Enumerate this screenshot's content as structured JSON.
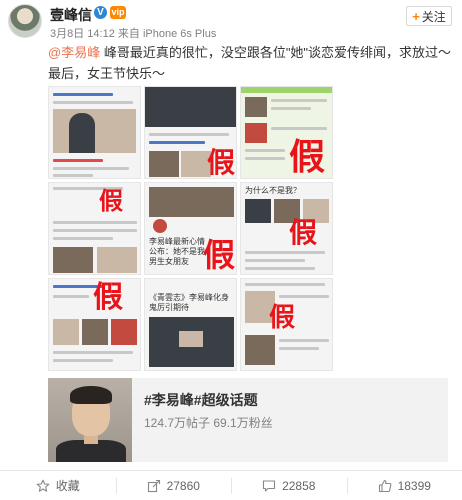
{
  "post": {
    "username": "壹峰信",
    "verified_badge": "V",
    "level_badge": "vip",
    "time": "3月8日 14:12",
    "source_prefix": "来自",
    "source": "iPhone 6s Plus",
    "follow_label": "关注",
    "mention": "@李易峰",
    "text": " 峰哥最近真的很忙，没空跟各位\"她\"谈恋爱传绯闻，求放过～最后，女王节快乐～"
  },
  "images": {
    "fake_mark": "假",
    "caption_left": "李易峰最新心情公布：她不是我男生女朋友",
    "caption_top": "为什么不是我？",
    "caption_bottom": "《青雲志》李易峰化身鬼厉引期待"
  },
  "topic": {
    "title": "#李易峰#超级话题",
    "posts": "124.7万帖子",
    "fans": "69.1万粉丝"
  },
  "actions": [
    {
      "icon": "star-icon",
      "label": "收藏"
    },
    {
      "icon": "share-icon",
      "label": "27860"
    },
    {
      "icon": "comment-icon",
      "label": "22858"
    },
    {
      "icon": "like-icon",
      "label": "18399"
    }
  ]
}
